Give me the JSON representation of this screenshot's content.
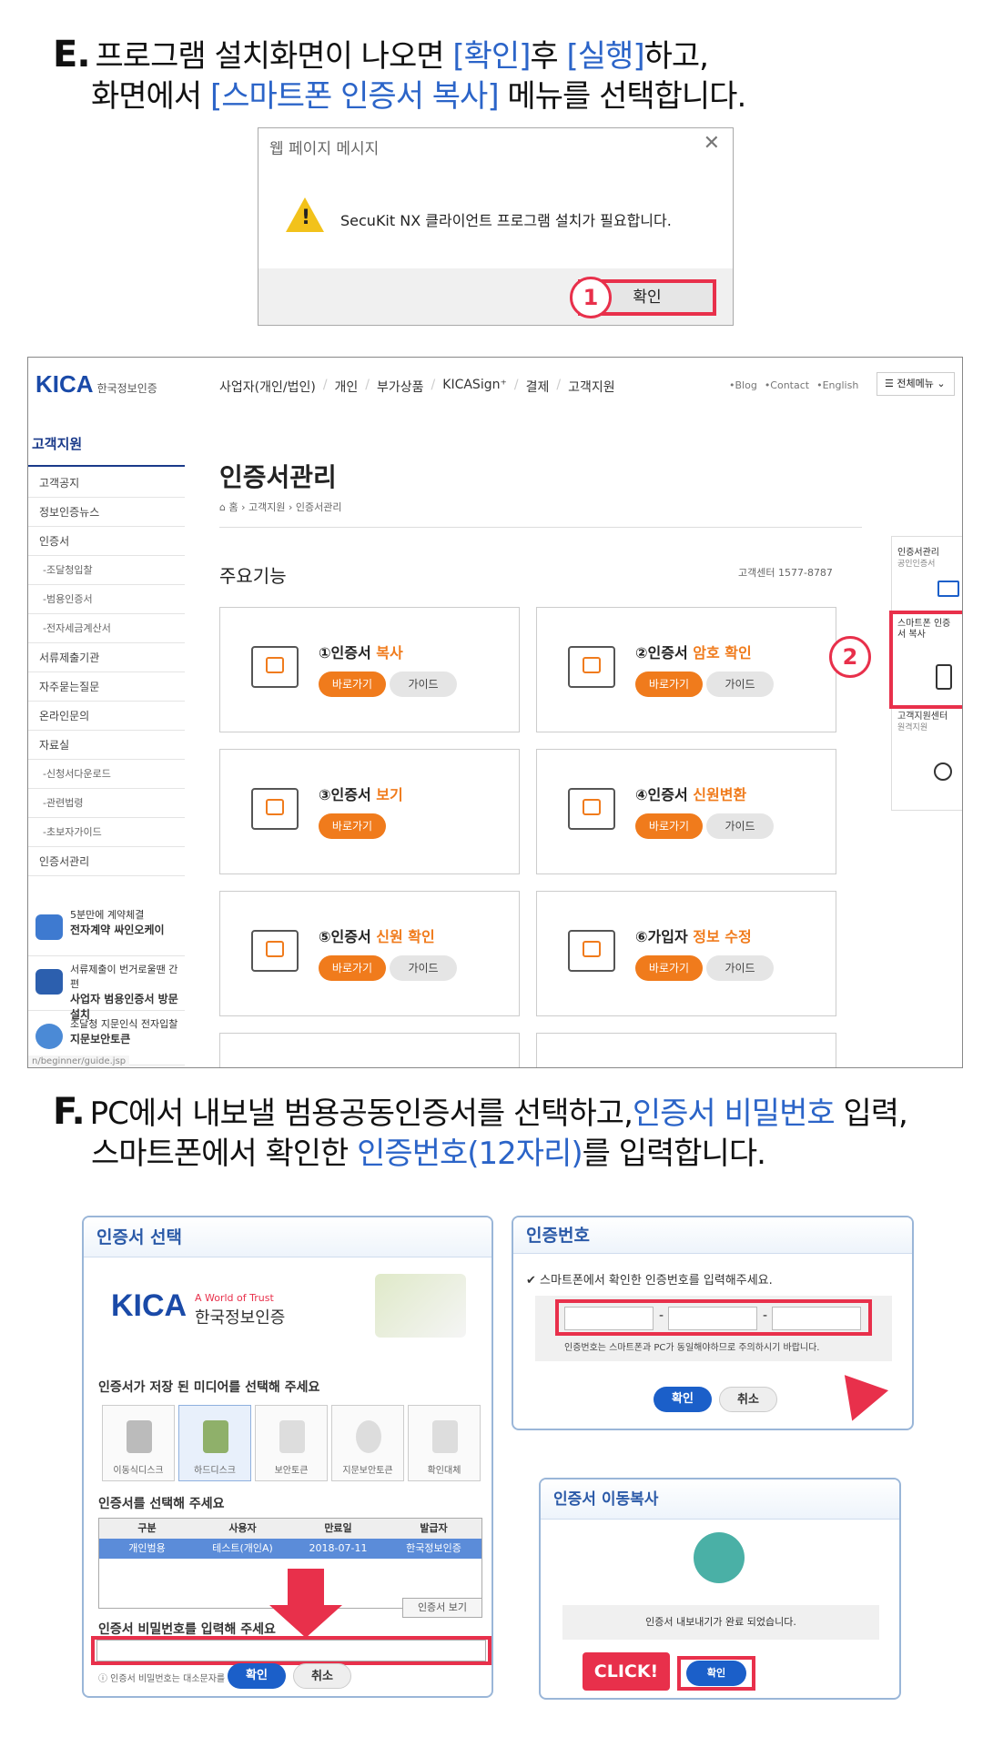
{
  "step_e": {
    "letter": "E.",
    "line1_a": "프로그램 설치화면이 나오면 ",
    "line1_b": "[확인]",
    "line1_c": "후 ",
    "line1_d": "[실행]",
    "line1_e": "하고,",
    "line2_a": "화면에서 ",
    "line2_b": "[스마트폰 인증서 복사]",
    "line2_c": " 메뉴를 선택합니다."
  },
  "dialog": {
    "title": "웹 페이지 메시지",
    "close": "✕",
    "message": "SecuKit NX 클라이언트 프로그램 설치가 필요합니다.",
    "ok": "확인",
    "warn_glyph": "!"
  },
  "markers": {
    "one": "1",
    "two": "2"
  },
  "site": {
    "logo": "KICA",
    "logo_sub": "한국정보인증",
    "gnb": [
      "사업자(개인/법인)",
      "개인",
      "부가상품",
      "KICASign⁺",
      "결제",
      "고객지원"
    ],
    "gnb_sep": "/",
    "util": [
      "•Blog",
      "•Contact",
      "•English"
    ],
    "menu_btn": "☰ 전체메뉴 ⌄",
    "side_title": "고객지원",
    "side_items": [
      {
        "label": "고객공지",
        "sub": false
      },
      {
        "label": "정보인증뉴스",
        "sub": false
      },
      {
        "label": "인증서",
        "sub": false
      },
      {
        "label": "-조달청입찰",
        "sub": true
      },
      {
        "label": "-범용인증서",
        "sub": true
      },
      {
        "label": "-전자세금계산서",
        "sub": true
      },
      {
        "label": "서류제출기관",
        "sub": false
      },
      {
        "label": "자주묻는질문",
        "sub": false
      },
      {
        "label": "온라인문의",
        "sub": false
      },
      {
        "label": "자료실",
        "sub": false
      },
      {
        "label": "-신청서다운로드",
        "sub": true
      },
      {
        "label": "-관련법령",
        "sub": true
      },
      {
        "label": "-초보자가이드",
        "sub": true
      },
      {
        "label": "인증서관리",
        "sub": false
      }
    ],
    "promos": [
      {
        "small": "5분만에 계약체결",
        "bold": "전자계약 싸인오케이"
      },
      {
        "small": "서류제출이 번거로울땐 간편",
        "bold": "사업자 범용인증서 방문설치"
      },
      {
        "small": "조달청 지문인식 전자입찰",
        "bold": "지문보안토큰"
      }
    ],
    "page_title": "인증서관리",
    "breadcrumb": "⌂ 홈 › 고객지원 › 인증서관리",
    "section_title": "주요기능",
    "phone": "고객센터 1577-8787",
    "status_url": "n/beginner/guide.jsp",
    "cards": [
      {
        "t1": "①인증서 ",
        "t2": "복사",
        "b1": "바로가기",
        "b2": ""
      },
      {
        "t1": "②인증서 ",
        "t2": "암호 확인",
        "b1": "바로가기",
        "b2": "가이드"
      },
      {
        "t1": "③인증서 ",
        "t2": "보기",
        "b1": "바로가기",
        "b2": ""
      },
      {
        "t1": "④인증서 ",
        "t2": "신원변환",
        "b1": "바로가기",
        "b2": "가이드"
      },
      {
        "t1": "⑤인증서 ",
        "t2": "신원 확인",
        "b1": "바로가기",
        "b2": "가이드"
      },
      {
        "t1": "⑥가입자 ",
        "t2": "정보 수정",
        "b1": "바로가기",
        "b2": "가이드"
      }
    ],
    "card1_guide": "가이드",
    "card3_guide": "",
    "quick": [
      {
        "title": "인증서관리",
        "sub": "공인인증서"
      },
      {
        "title": "스마트폰 인증서 복사",
        "sub": ""
      },
      {
        "title": "고객지원센터",
        "sub": "원격지원"
      }
    ]
  },
  "step_f": {
    "letter": "F.",
    "line1_a": "PC에서 내보낼 범용공동인증서를 선택하고,",
    "line1_b": "인증서 비밀번호",
    "line1_c": " 입력,",
    "line2_a": "스마트폰에서 확인한 ",
    "line2_b": "인증번호(12자리)",
    "line2_c": "를 입력합니다."
  },
  "cert_select": {
    "title": "인증서 선택",
    "logo": "KICA",
    "logo_tag": "A World of Trust",
    "logo_sub": "한국정보인증",
    "media_label": "인증서가 저장 된 미디어를 선택해 주세요",
    "media": [
      "이동식디스크",
      "하드디스크",
      "보안토큰",
      "지문보안토큰",
      "확인대체"
    ],
    "list_label": "인증서를 선택해 주세요",
    "columns": [
      "구분",
      "사용자",
      "만료일",
      "발급자"
    ],
    "row": [
      "개인범용",
      "테스트(개인A)",
      "2018-07-11",
      "한국정보인증"
    ],
    "view_btn": "인증서 보기",
    "pw_label": "인증서 비밀번호를 입력해 주세요",
    "pw_note": "ⓘ 인증서 비밀번호는 대소문자를 구분합니다.",
    "ok": "확인",
    "cancel": "취소"
  },
  "auth_number": {
    "title": "인증번호",
    "prompt": "✔ 스마트폰에서 확인한 인증번호를 입력해주세요.",
    "dash": "-",
    "note": "인증번호는 스마트폰과 PC가 동일해야하므로 주의하시기 바랍니다.",
    "ok": "확인",
    "cancel": "취소"
  },
  "move_copy": {
    "title": "인증서 이동복사",
    "message": "인증서 내보내기가 완료 되었습니다.",
    "click": "CLICK!",
    "ok": "확인"
  },
  "colors": {
    "accent_blue": "#2b64c8",
    "highlight_red": "#e8304b",
    "orange": "#f07b1c"
  }
}
